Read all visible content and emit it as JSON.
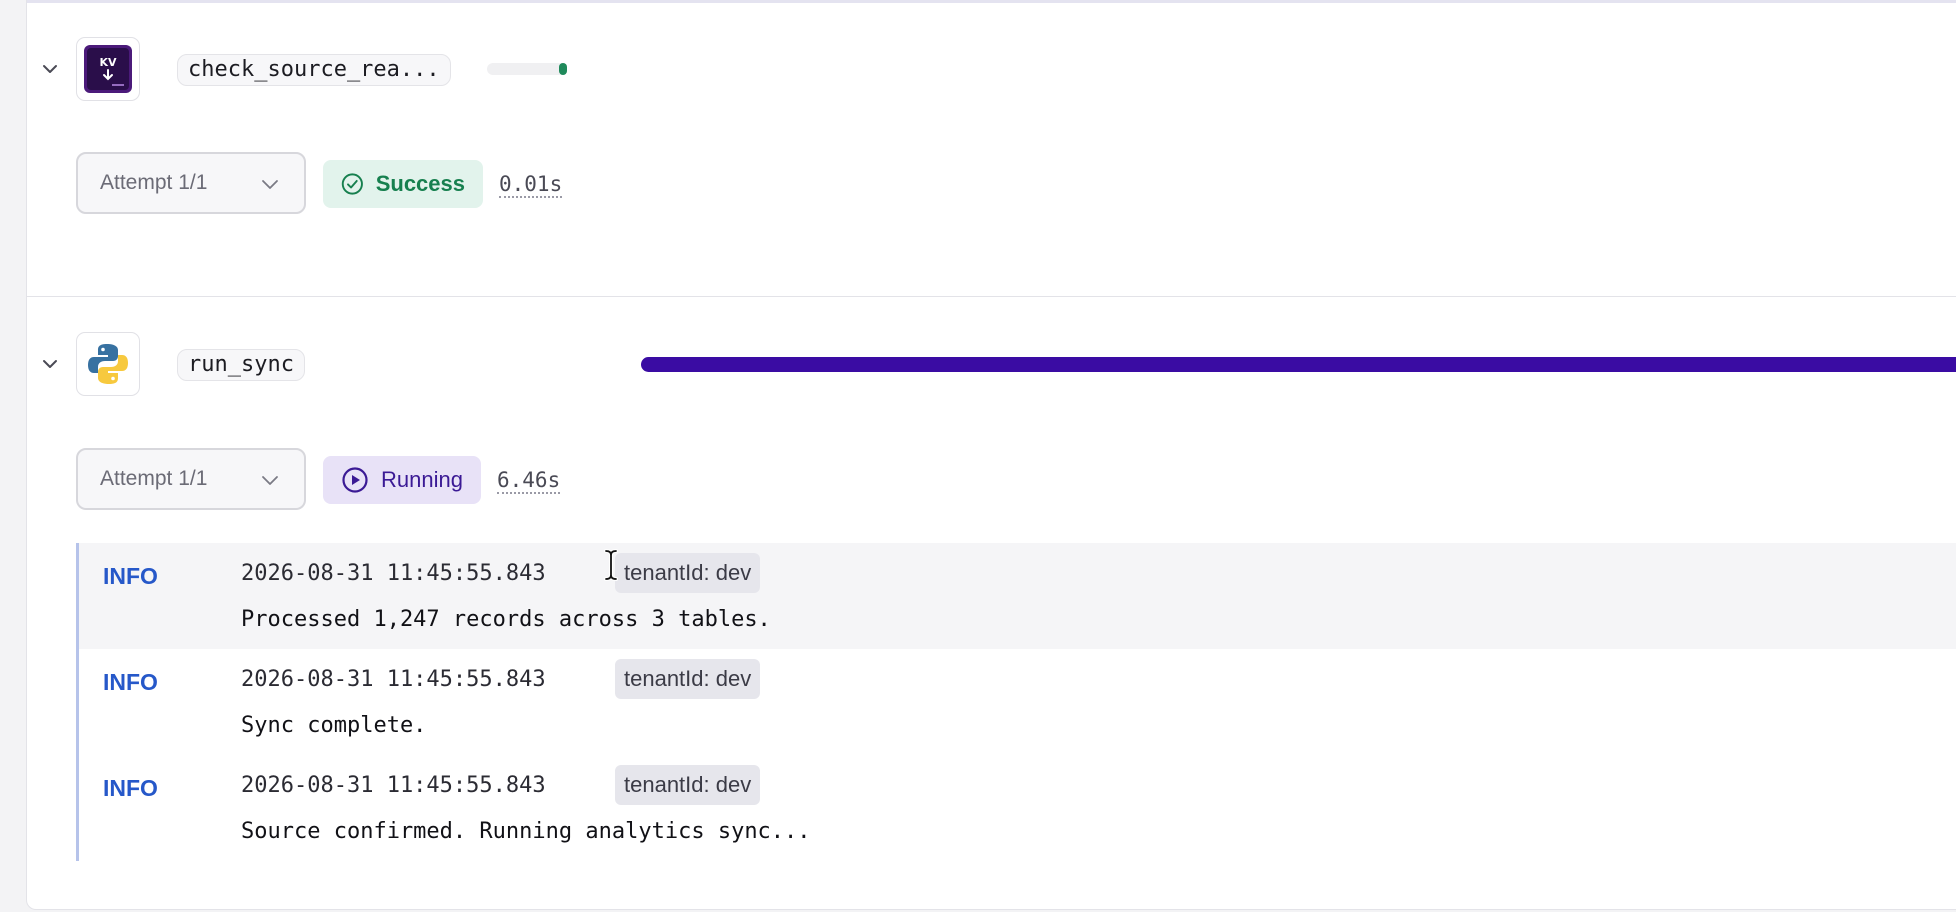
{
  "tasks": [
    {
      "name": "check_source_rea...",
      "icon": "kv-store-icon",
      "icon_text": "KV",
      "attempt_label": "Attempt 1/1",
      "status": "Success",
      "duration": "0.01s",
      "progress": 0.05,
      "bar_color": "#1f8a5b"
    },
    {
      "name": "run_sync",
      "icon": "python-icon",
      "attempt_label": "Attempt 1/1",
      "status": "Running",
      "duration": "6.46s",
      "progress": 1.0,
      "bar_color": "#3a0ca3"
    }
  ],
  "logs": [
    {
      "level": "INFO",
      "timestamp": "2026-08-31 11:45:55.843",
      "tag": "tenantId: dev",
      "message": "Processed 1,247 records across 3 tables."
    },
    {
      "level": "INFO",
      "timestamp": "2026-08-31 11:45:55.843",
      "tag": "tenantId: dev",
      "message": "Sync complete."
    },
    {
      "level": "INFO",
      "timestamp": "2026-08-31 11:45:55.843",
      "tag": "tenantId: dev",
      "message": "Source confirmed. Running analytics sync..."
    }
  ],
  "colors": {
    "success": "#17804f",
    "running": "#3b1a95",
    "info": "#2658c9"
  }
}
